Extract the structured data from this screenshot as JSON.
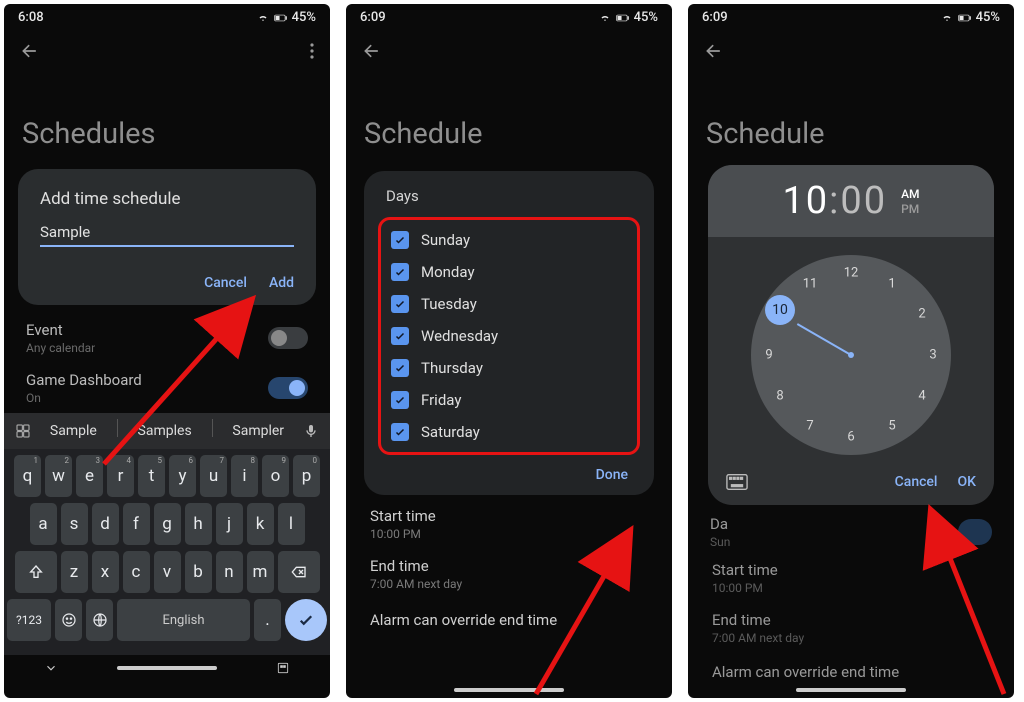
{
  "status": {
    "time1": "6:08",
    "time2": "6:09",
    "time3": "6:09",
    "battery": "45%"
  },
  "screen1": {
    "heading": "Schedules",
    "dialog": {
      "title": "Add time schedule",
      "input_value": "Sample",
      "cancel": "Cancel",
      "add": "Add"
    },
    "event": {
      "label": "Event",
      "sub": "Any calendar"
    },
    "game": {
      "label": "Game Dashboard",
      "sub": "On"
    },
    "suggestions": [
      "Sample",
      "Samples",
      "Sampler"
    ],
    "keyboard": {
      "row1": [
        "q",
        "w",
        "e",
        "r",
        "t",
        "y",
        "u",
        "i",
        "o",
        "p"
      ],
      "row1_hints": [
        "1",
        "2",
        "3",
        "4",
        "5",
        "6",
        "7",
        "8",
        "9",
        "0"
      ],
      "row2": [
        "a",
        "s",
        "d",
        "f",
        "g",
        "h",
        "j",
        "k",
        "l"
      ],
      "row3": [
        "z",
        "x",
        "c",
        "v",
        "b",
        "n",
        "m"
      ],
      "shift": "⇧",
      "backspace": "⌫",
      "numkey": "?123",
      "comma": ",",
      "lang": "English",
      "period": "."
    }
  },
  "screen2": {
    "heading": "Schedule",
    "card_title": "Days",
    "days": [
      "Sunday",
      "Monday",
      "Tuesday",
      "Wednesday",
      "Thursday",
      "Friday",
      "Saturday"
    ],
    "done": "Done",
    "start": {
      "label": "Start time",
      "value": "10:00 PM"
    },
    "end": {
      "label": "End time",
      "value": "7:00 AM next day"
    },
    "alarm": "Alarm can override end time"
  },
  "screen3": {
    "heading": "Schedule",
    "time_hour": "10",
    "time_sep": ":",
    "time_min": "00",
    "am": "AM",
    "pm": "PM",
    "cancel": "Cancel",
    "ok": "OK",
    "hours": [
      "12",
      "1",
      "2",
      "3",
      "4",
      "5",
      "6",
      "7",
      "8",
      "9",
      "10",
      "11"
    ],
    "selected_hour": "10",
    "da": {
      "label": "Da",
      "sub": "Sun"
    },
    "start": {
      "label": "Start time",
      "value": "10:00 PM"
    },
    "end": {
      "label": "End time",
      "value": "7:00 AM next day"
    },
    "alarm": "Alarm can override end time"
  }
}
